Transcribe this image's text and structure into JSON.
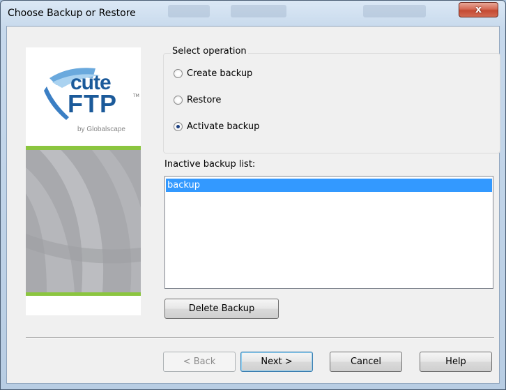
{
  "window": {
    "title": "Choose Backup or Restore",
    "close_glyph": "x"
  },
  "sidebar": {
    "logo_line1": "cute",
    "logo_line2": "FTP",
    "logo_tm": "TM",
    "logo_byline": "by Globalscape"
  },
  "operation": {
    "group_title": "Select operation",
    "options": [
      {
        "label": "Create backup",
        "checked": false
      },
      {
        "label": "Restore",
        "checked": false
      },
      {
        "label": "Activate backup",
        "checked": true
      }
    ]
  },
  "backup_list": {
    "label": "Inactive backup list:",
    "items": [
      "backup"
    ],
    "selected_index": 0
  },
  "buttons": {
    "delete_backup": "Delete Backup",
    "back": "< Back",
    "next": "Next >",
    "cancel": "Cancel",
    "help": "Help"
  },
  "colors": {
    "selection": "#3399ff",
    "accent_green": "#8bc53f",
    "logo_blue": "#1b5a9a"
  }
}
